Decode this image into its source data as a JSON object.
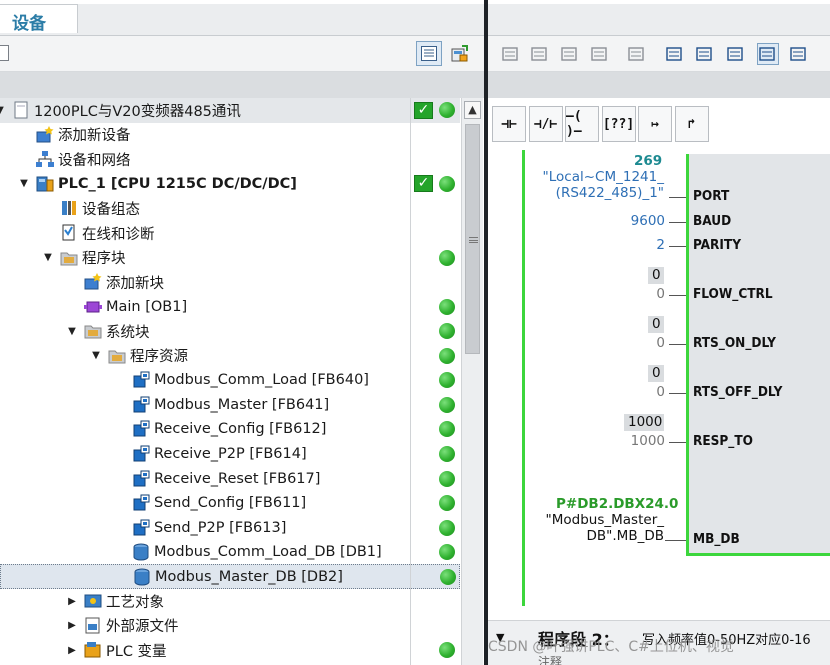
{
  "left_panel": {
    "tab_title": "设备",
    "toolbar": {
      "list_view_icon": "list-view-icon",
      "overview_icon": "overview-icon"
    },
    "tree": [
      {
        "label": "1200PLC与V20变频器485通讯",
        "icon": "project-icon",
        "caret": "expanded",
        "check": true,
        "status": "ok"
      },
      {
        "label": "添加新设备",
        "icon": "add-device-icon",
        "caret": "none",
        "check": false,
        "status": "none"
      },
      {
        "label": "设备和网络",
        "icon": "network-icon",
        "caret": "none",
        "check": false,
        "status": "none"
      },
      {
        "label": "PLC_1 [CPU 1215C DC/DC/DC]",
        "icon": "plc-icon",
        "caret": "expanded",
        "check": true,
        "status": "ok"
      },
      {
        "label": "设备组态",
        "icon": "device-config-icon",
        "caret": "none",
        "check": false,
        "status": "none"
      },
      {
        "label": "在线和诊断",
        "icon": "online-diagnostics-icon",
        "caret": "none",
        "check": false,
        "status": "none"
      },
      {
        "label": "程序块",
        "icon": "folder-icon",
        "caret": "expanded",
        "check": false,
        "status": "ok"
      },
      {
        "label": "添加新块",
        "icon": "add-block-icon",
        "caret": "none",
        "check": false,
        "status": "none"
      },
      {
        "label": "Main [OB1]",
        "icon": "ob-icon",
        "caret": "none",
        "check": false,
        "status": "ok"
      },
      {
        "label": "系统块",
        "icon": "folder-icon",
        "caret": "expanded",
        "check": false,
        "status": "ok"
      },
      {
        "label": "程序资源",
        "icon": "folder-icon",
        "caret": "expanded",
        "check": false,
        "status": "ok"
      },
      {
        "label": "Modbus_Comm_Load [FB640]",
        "icon": "fb-icon",
        "caret": "none",
        "check": false,
        "status": "ok"
      },
      {
        "label": "Modbus_Master [FB641]",
        "icon": "fb-icon",
        "caret": "none",
        "check": false,
        "status": "ok"
      },
      {
        "label": "Receive_Config [FB612]",
        "icon": "fb-icon",
        "caret": "none",
        "check": false,
        "status": "ok"
      },
      {
        "label": "Receive_P2P [FB614]",
        "icon": "fb-icon",
        "caret": "none",
        "check": false,
        "status": "ok"
      },
      {
        "label": "Receive_Reset [FB617]",
        "icon": "fb-icon",
        "caret": "none",
        "check": false,
        "status": "ok"
      },
      {
        "label": "Send_Config [FB611]",
        "icon": "fb-icon",
        "caret": "none",
        "check": false,
        "status": "ok"
      },
      {
        "label": "Send_P2P [FB613]",
        "icon": "fb-icon",
        "caret": "none",
        "check": false,
        "status": "ok"
      },
      {
        "label": "Modbus_Comm_Load_DB [DB1]",
        "icon": "db-icon",
        "caret": "none",
        "check": false,
        "status": "ok"
      },
      {
        "label": "Modbus_Master_DB [DB2]",
        "icon": "db-icon",
        "caret": "none",
        "check": false,
        "status": "ok",
        "selected": true
      },
      {
        "label": "工艺对象",
        "icon": "tech-object-icon",
        "caret": "collapsed",
        "check": false,
        "status": "none"
      },
      {
        "label": "外部源文件",
        "icon": "external-source-icon",
        "caret": "collapsed",
        "check": false,
        "status": "none"
      },
      {
        "label": "PLC 变量",
        "icon": "plc-tags-icon",
        "caret": "collapsed",
        "check": false,
        "status": "ok"
      }
    ]
  },
  "right_panel": {
    "toolbar_icons": [
      "insert-network-icon",
      "delete-network-icon",
      "insert-row-icon",
      "add-row-icon",
      "set-absolute-icon",
      "show-all-comments-icon",
      "collapse-icon",
      "expand-icon",
      "comment-icon",
      "monitor-icon"
    ],
    "ladder_buttons": [
      "⊣⊢",
      "⊣/⊢",
      "–( )–",
      "[??]",
      "↦",
      "↱"
    ],
    "block_instance_no": "269",
    "params": [
      {
        "name": "PORT",
        "value": "\"Local~CM_1241_",
        "value2": "(RS422_485)_1\"",
        "style": "blue"
      },
      {
        "name": "BAUD",
        "value": "9600",
        "style": "blue"
      },
      {
        "name": "PARITY",
        "value": "2",
        "style": "blue"
      },
      {
        "name": "FLOW_CTRL",
        "monitor": "0",
        "value": "0",
        "style": "gray"
      },
      {
        "name": "RTS_ON_DLY",
        "monitor": "0",
        "value": "0",
        "style": "gray"
      },
      {
        "name": "RTS_OFF_DLY",
        "monitor": "0",
        "value": "0",
        "style": "gray"
      },
      {
        "name": "RESP_TO",
        "monitor": "1000",
        "value": "1000",
        "style": "gray"
      },
      {
        "name": "MB_DB",
        "address": "P#DB2.DBX24.0",
        "value": "\"Modbus_Master_",
        "value2": "DB\".MB_DB",
        "style": "black"
      }
    ],
    "segment": {
      "title": "程序段 2：",
      "description": "写入频率值0-50HZ对应0-16",
      "comment": "注释"
    }
  },
  "watermark": "CSDN @叶强讲PLC、C#上位机、视觉"
}
